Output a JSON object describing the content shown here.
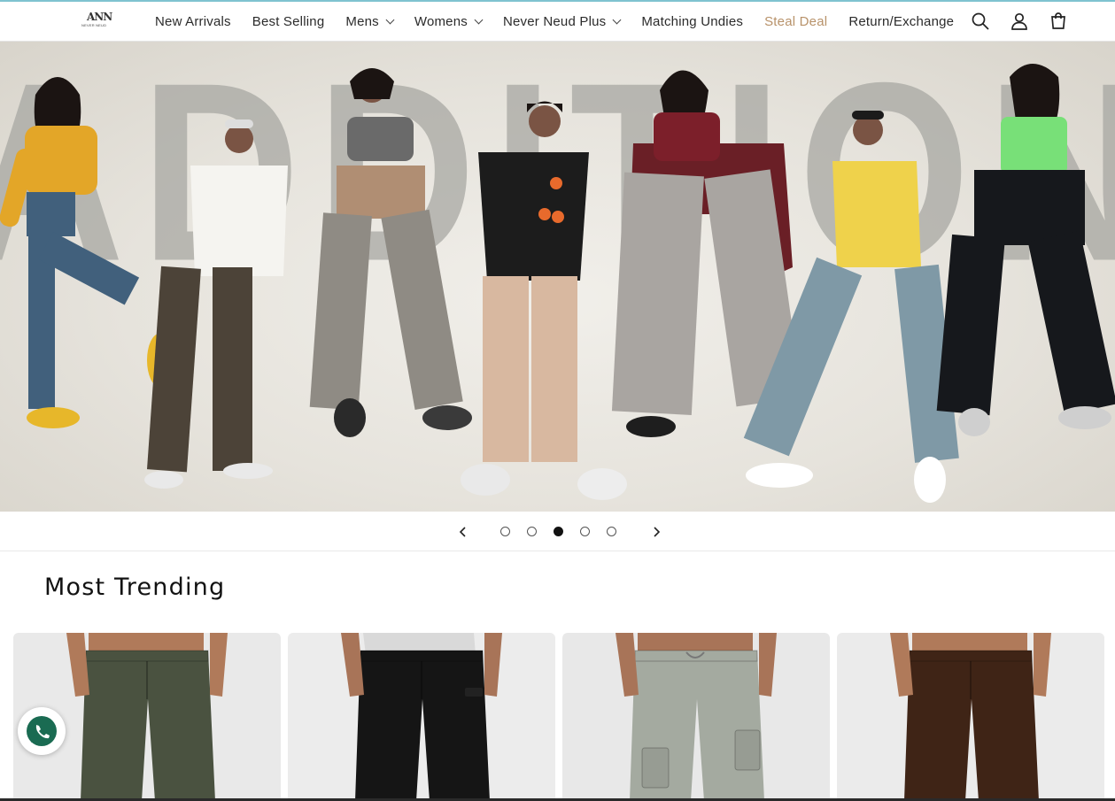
{
  "brand": {
    "logo_mark": "ANN",
    "logo_sub": "NEVER NEUD"
  },
  "nav": [
    {
      "label": "New Arrivals",
      "has_dropdown": false
    },
    {
      "label": "Best Selling",
      "has_dropdown": false
    },
    {
      "label": "Mens",
      "has_dropdown": true
    },
    {
      "label": "Womens",
      "has_dropdown": true
    },
    {
      "label": "Never Neud Plus",
      "has_dropdown": true
    },
    {
      "label": "Matching Undies",
      "has_dropdown": false
    },
    {
      "label": "Steal Deal",
      "has_dropdown": false,
      "highlight_color": "#b8926a"
    },
    {
      "label": "Return/Exchange",
      "has_dropdown": false
    }
  ],
  "header_icons": [
    "search-icon",
    "account-icon",
    "cart-icon"
  ],
  "hero": {
    "background_word": "ADDITIONS",
    "slide_count": 5,
    "active_slide": 3
  },
  "trending": {
    "title": "Most Trending",
    "products": [
      {
        "pant_color": "#4a5240",
        "bg_color": "#e9e9e9",
        "style": "jeans"
      },
      {
        "pant_color": "#151515",
        "bg_color": "#ececec",
        "style": "trouser"
      },
      {
        "pant_color": "#a4aaa0",
        "bg_color": "#e8e8e8",
        "style": "cargo"
      },
      {
        "pant_color": "#3f2416",
        "bg_color": "#ebebeb",
        "style": "jeans"
      }
    ]
  },
  "colors": {
    "accent_line": "#7fc3d0",
    "steal_deal": "#b8926a",
    "whatsapp": "#1a6b52"
  }
}
